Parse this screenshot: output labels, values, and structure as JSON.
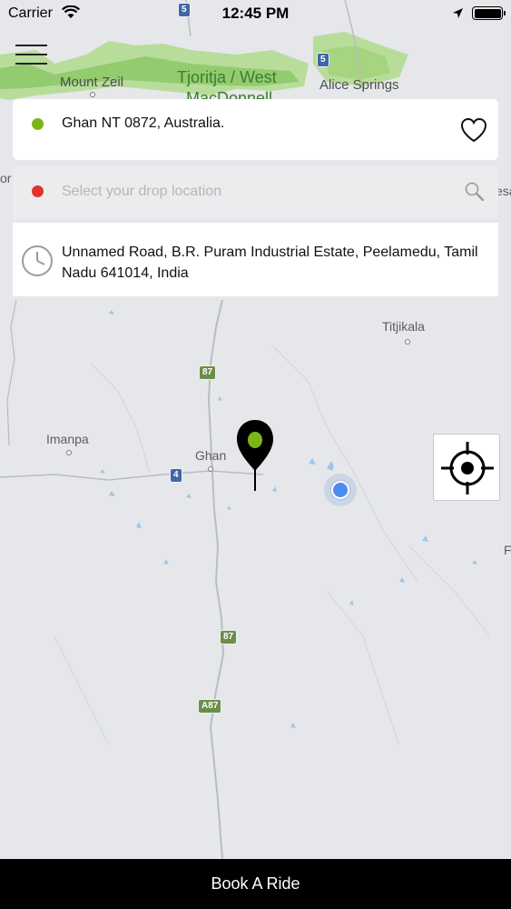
{
  "status_bar": {
    "carrier": "Carrier",
    "time": "12:45 PM",
    "icons": [
      "wifi-icon",
      "location-arrow-icon",
      "battery-icon"
    ]
  },
  "map": {
    "labels": {
      "mount_zeil": "Mount Zeil",
      "tjoritja_line1": "Tjoritja / West",
      "tjoritja_line2": "MacDonnell",
      "alice_springs": "Alice Springs",
      "titjikala": "Titjikala",
      "imanpa": "Imanpa",
      "ghan": "Ghan",
      "left_edge": "or",
      "right_edge_top": "esa",
      "right_edge_mid": "F"
    },
    "route_shields": {
      "r5_top": "5",
      "r5_right": "5",
      "r87_upper": "87",
      "r4": "4",
      "r87_lower": "87",
      "a87": "A87"
    }
  },
  "pickup": {
    "address": "Ghan NT 0872, Australia.",
    "dot_color": "#7cb518"
  },
  "drop": {
    "placeholder": "Select your drop location",
    "value": "",
    "dot_color": "#e0342b"
  },
  "recent": {
    "address": "Unnamed Road, B.R. Puram Industrial Estate, Peelamedu, Tamil Nadu 641014, India"
  },
  "book_button": {
    "label": "Book A Ride"
  },
  "colors": {
    "accent_green": "#7cb518",
    "drop_red": "#e0342b",
    "user_location_blue": "#4a8cf0",
    "book_bar": "#000000"
  }
}
